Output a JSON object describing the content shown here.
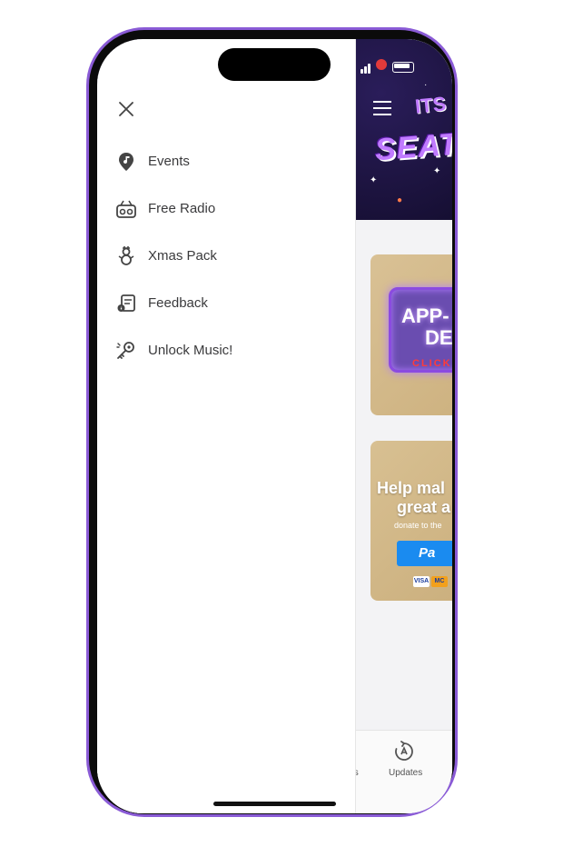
{
  "drawer": {
    "close_icon": "close-icon",
    "items": [
      {
        "label": "Events",
        "icon": "music-location-icon"
      },
      {
        "label": "Free Radio",
        "icon": "radio-icon"
      },
      {
        "label": "Xmas Pack",
        "icon": "snowman-icon"
      },
      {
        "label": "Feedback",
        "icon": "feedback-icon"
      },
      {
        "label": "Unlock Music!",
        "icon": "key-icon"
      }
    ]
  },
  "app": {
    "menu_icon": "hamburger-icon",
    "banner": {
      "line1": "ITS",
      "line2": "SEAT"
    },
    "cards": [
      {
        "line1": "APP-",
        "line2": "DEA",
        "action": "CLICK"
      },
      {
        "line1": "Help mal",
        "line2": "great a",
        "subtext": "donate to the",
        "button": "Pa",
        "cards": [
          "VISA",
          "MC"
        ]
      }
    ],
    "tabbar": {
      "partial_tab_label": "ts",
      "updates_label": "Updates"
    }
  },
  "colors": {
    "frame": "#8a5bd6",
    "drawer_bg": "#ffffff",
    "text": "#3a3a3c",
    "header_bg": "#120c2b",
    "paypal": "#1a8bf0"
  }
}
